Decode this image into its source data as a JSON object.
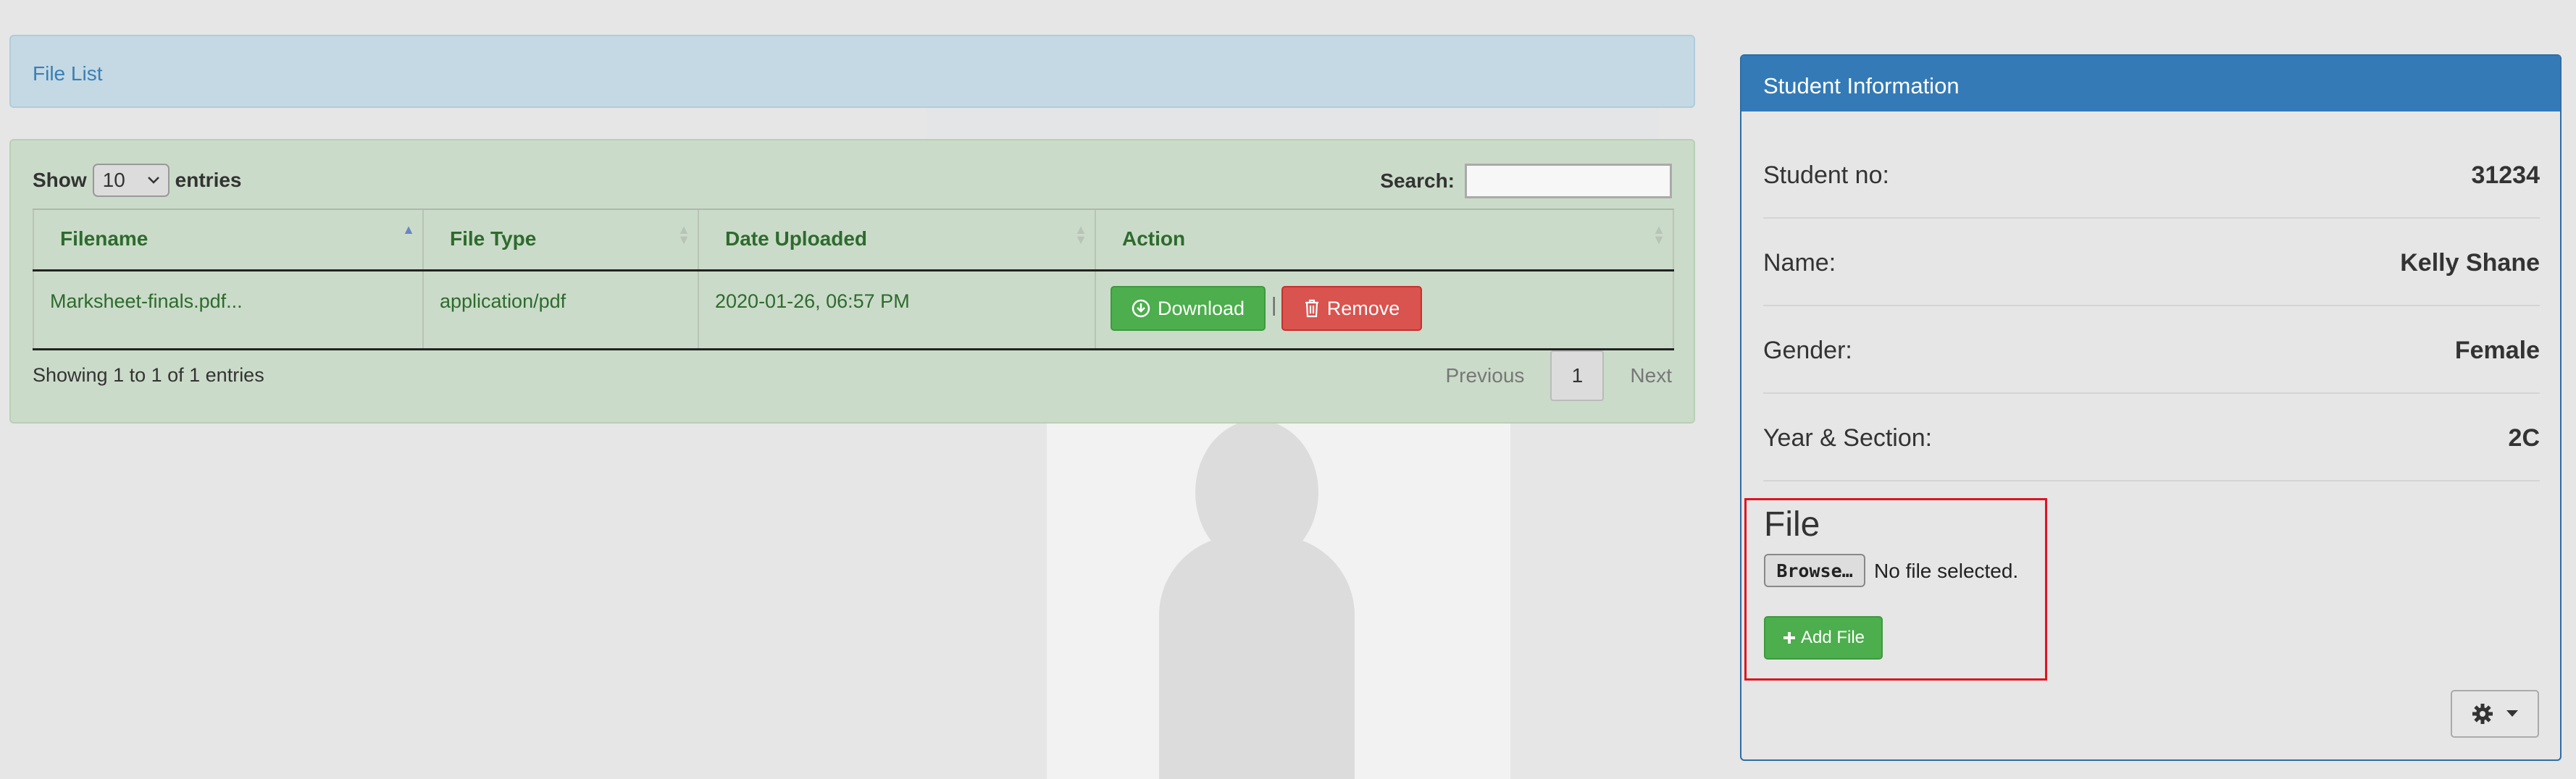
{
  "file_list_header": "File List",
  "table_controls": {
    "show_label": "Show",
    "entries_value": "10",
    "entries_label": "entries",
    "search_label": "Search:",
    "search_value": ""
  },
  "table": {
    "columns": [
      "Filename",
      "File Type",
      "Date Uploaded",
      "Action"
    ],
    "rows": [
      {
        "filename": "Marksheet-finals.pdf...",
        "file_type": "application/pdf",
        "date_uploaded": "2020-01-26, 06:57 PM"
      }
    ],
    "download_label": "Download",
    "remove_label": "Remove",
    "separator": "|"
  },
  "pagination": {
    "summary": "Showing 1 to 1 of 1 entries",
    "previous": "Previous",
    "current_page": "1",
    "next": "Next"
  },
  "student_panel": {
    "title": "Student Information",
    "fields": [
      {
        "label": "Student no:",
        "value": "31234"
      },
      {
        "label": "Name:",
        "value": "Kelly Shane"
      },
      {
        "label": "Gender:",
        "value": "Female"
      },
      {
        "label": "Year & Section:",
        "value": "2C"
      }
    ],
    "file_section_title": "File",
    "browse_label": "Browse…",
    "no_file_text": "No file selected.",
    "add_file_label": "Add File"
  },
  "icons": {
    "download": "download-icon",
    "remove": "trash-icon",
    "add": "plus-icon",
    "settings": "gear-icon",
    "dropdown": "caret-down-icon"
  },
  "colors": {
    "primary": "#337ab7",
    "success": "#4cae4c",
    "danger": "#d9534f",
    "highlight_border": "#e0131f"
  }
}
